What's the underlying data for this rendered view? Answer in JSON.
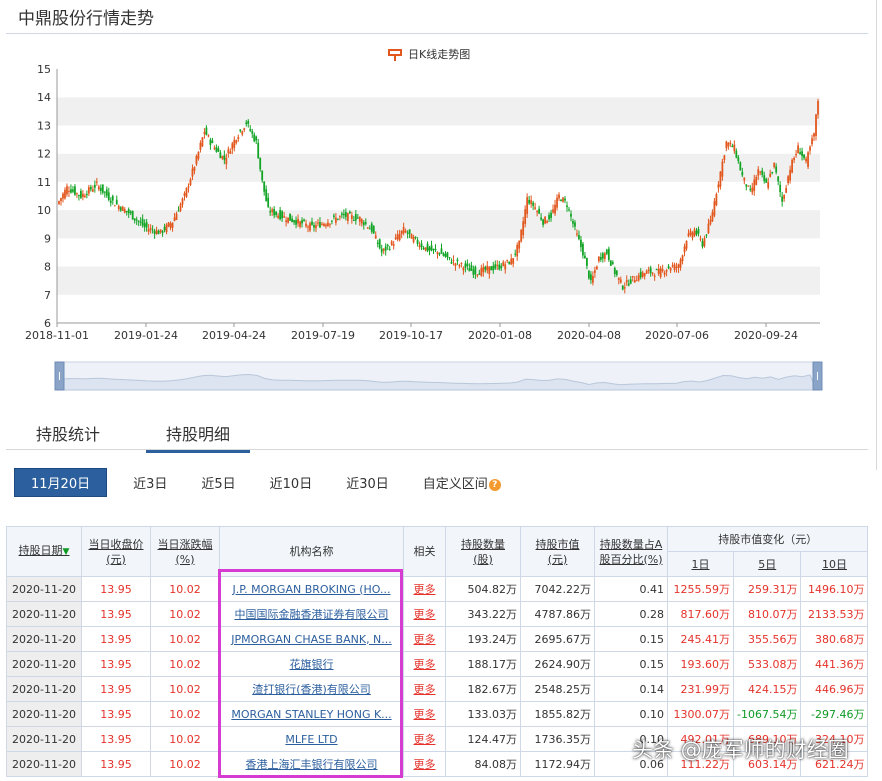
{
  "page_title": "中鼎股份行情走势",
  "chart_data": {
    "type": "candlestick",
    "legend": "日K线走势图",
    "ylim": [
      6,
      15
    ],
    "y_ticks": [
      "6",
      "7",
      "8",
      "9",
      "10",
      "11",
      "12",
      "13",
      "14",
      "15"
    ],
    "x_ticks": [
      "2018-11-01",
      "2019-01-24",
      "2019-04-24",
      "2019-07-19",
      "2019-10-17",
      "2020-01-08",
      "2020-04-08",
      "2020-07-06",
      "2020-09-24"
    ],
    "close_path": [
      [
        0,
        10.2
      ],
      [
        5,
        10.8
      ],
      [
        12,
        10.5
      ],
      [
        20,
        10.9
      ],
      [
        28,
        10.3
      ],
      [
        36,
        9.9
      ],
      [
        44,
        9.4
      ],
      [
        52,
        9.2
      ],
      [
        58,
        9.6
      ],
      [
        64,
        10.5
      ],
      [
        70,
        11.8
      ],
      [
        74,
        12.8
      ],
      [
        78,
        12.3
      ],
      [
        84,
        11.8
      ],
      [
        90,
        12.6
      ],
      [
        95,
        13.1
      ],
      [
        100,
        12.4
      ],
      [
        103,
        11.0
      ],
      [
        106,
        10.0
      ],
      [
        112,
        9.8
      ],
      [
        120,
        9.6
      ],
      [
        128,
        9.4
      ],
      [
        136,
        9.6
      ],
      [
        144,
        9.8
      ],
      [
        152,
        9.7
      ],
      [
        158,
        9.3
      ],
      [
        163,
        8.5
      ],
      [
        168,
        8.8
      ],
      [
        174,
        9.3
      ],
      [
        180,
        8.9
      ],
      [
        186,
        8.6
      ],
      [
        192,
        8.5
      ],
      [
        198,
        8.2
      ],
      [
        204,
        8.0
      ],
      [
        210,
        7.8
      ],
      [
        216,
        7.9
      ],
      [
        222,
        8.0
      ],
      [
        228,
        8.2
      ],
      [
        232,
        8.8
      ],
      [
        236,
        10.4
      ],
      [
        240,
        10.1
      ],
      [
        244,
        9.6
      ],
      [
        248,
        9.8
      ],
      [
        252,
        10.5
      ],
      [
        256,
        10.2
      ],
      [
        260,
        9.3
      ],
      [
        264,
        8.5
      ],
      [
        268,
        7.4
      ],
      [
        272,
        8.3
      ],
      [
        276,
        8.5
      ],
      [
        280,
        7.8
      ],
      [
        284,
        7.3
      ],
      [
        290,
        7.6
      ],
      [
        296,
        7.8
      ],
      [
        302,
        7.8
      ],
      [
        308,
        8.0
      ],
      [
        312,
        8.0
      ],
      [
        316,
        9.0
      ],
      [
        320,
        9.3
      ],
      [
        324,
        8.8
      ],
      [
        328,
        9.6
      ],
      [
        332,
        11.0
      ],
      [
        336,
        12.4
      ],
      [
        340,
        12.2
      ],
      [
        344,
        11.2
      ],
      [
        348,
        10.6
      ],
      [
        352,
        11.4
      ],
      [
        356,
        10.9
      ],
      [
        360,
        11.6
      ],
      [
        364,
        10.3
      ],
      [
        368,
        11.5
      ],
      [
        372,
        12.2
      ],
      [
        376,
        11.7
      ],
      [
        380,
        12.7
      ],
      [
        382,
        13.9
      ]
    ],
    "series_colors": {
      "up": "#e2571e",
      "down": "#12a425"
    }
  },
  "tabs": [
    {
      "label": "持股统计",
      "active": false
    },
    {
      "label": "持股明细",
      "active": true
    }
  ],
  "ranges": [
    {
      "label": "11月20日",
      "active": true
    },
    {
      "label": "近3日",
      "active": false
    },
    {
      "label": "近5日",
      "active": false
    },
    {
      "label": "近10日",
      "active": false
    },
    {
      "label": "近30日",
      "active": false
    },
    {
      "label": "自定义区间",
      "active": false
    }
  ],
  "table": {
    "headers": {
      "date": "持股日期",
      "close_a": "当日收盘价",
      "close_b": "(元)",
      "change_a": "当日涨跌幅",
      "change_b": "(%)",
      "org": "机构名称",
      "related": "相关",
      "qty_a": "持股数量",
      "qty_b": "(股)",
      "mv_a": "持股市值",
      "mv_b": "(元)",
      "pct_a": "持股数量占A",
      "pct_b": "股百分比(%)",
      "chg_group": "持股市值变化（元）",
      "d1": "1日",
      "d5": "5日",
      "d10": "10日"
    },
    "rows": [
      {
        "date": "2020-11-20",
        "close": "13.95",
        "change": "10.02",
        "org": "J.P. MORGAN BROKING (HO...",
        "more": "更多",
        "qty": "504.82万",
        "mv": "7042.22万",
        "pct": "0.41",
        "d1": "1255.59万",
        "d5": "259.31万",
        "d10": "1496.10万",
        "d1_dir": "up",
        "d5_dir": "up",
        "d10_dir": "up"
      },
      {
        "date": "2020-11-20",
        "close": "13.95",
        "change": "10.02",
        "org": "中国国际金融香港证券有限公司",
        "more": "更多",
        "qty": "343.22万",
        "mv": "4787.86万",
        "pct": "0.28",
        "d1": "817.60万",
        "d5": "810.07万",
        "d10": "2133.53万",
        "d1_dir": "up",
        "d5_dir": "up",
        "d10_dir": "up"
      },
      {
        "date": "2020-11-20",
        "close": "13.95",
        "change": "10.02",
        "org": "JPMORGAN CHASE BANK, N...",
        "more": "更多",
        "qty": "193.24万",
        "mv": "2695.67万",
        "pct": "0.15",
        "d1": "245.41万",
        "d5": "355.56万",
        "d10": "380.68万",
        "d1_dir": "up",
        "d5_dir": "up",
        "d10_dir": "up"
      },
      {
        "date": "2020-11-20",
        "close": "13.95",
        "change": "10.02",
        "org": "花旗银行",
        "more": "更多",
        "qty": "188.17万",
        "mv": "2624.90万",
        "pct": "0.15",
        "d1": "193.60万",
        "d5": "533.08万",
        "d10": "441.36万",
        "d1_dir": "up",
        "d5_dir": "up",
        "d10_dir": "up"
      },
      {
        "date": "2020-11-20",
        "close": "13.95",
        "change": "10.02",
        "org": "渣打银行(香港)有限公司",
        "more": "更多",
        "qty": "182.67万",
        "mv": "2548.25万",
        "pct": "0.14",
        "d1": "231.99万",
        "d5": "424.15万",
        "d10": "446.96万",
        "d1_dir": "up",
        "d5_dir": "up",
        "d10_dir": "up"
      },
      {
        "date": "2020-11-20",
        "close": "13.95",
        "change": "10.02",
        "org": "MORGAN STANLEY HONG K...",
        "more": "更多",
        "qty": "133.03万",
        "mv": "1855.82万",
        "pct": "0.10",
        "d1": "1300.07万",
        "d5": "-1067.54万",
        "d10": "-297.46万",
        "d1_dir": "up",
        "d5_dir": "down",
        "d10_dir": "down"
      },
      {
        "date": "2020-11-20",
        "close": "13.95",
        "change": "10.02",
        "org": "MLFE LTD",
        "more": "更多",
        "qty": "124.47万",
        "mv": "1736.35万",
        "pct": "0.10",
        "d1": "492.01万",
        "d5": "689.10万",
        "d10": "324.10万",
        "d1_dir": "up",
        "d5_dir": "up",
        "d10_dir": "up"
      },
      {
        "date": "2020-11-20",
        "close": "13.95",
        "change": "10.02",
        "org": "香港上海汇丰银行有限公司",
        "more": "更多",
        "qty": "84.08万",
        "mv": "1172.94万",
        "pct": "0.06",
        "d1": "111.22万",
        "d5": "603.14万",
        "d10": "621.24万",
        "d1_dir": "up",
        "d5_dir": "up",
        "d10_dir": "up"
      }
    ]
  },
  "watermark": "头条 @庞军师的财经圈"
}
